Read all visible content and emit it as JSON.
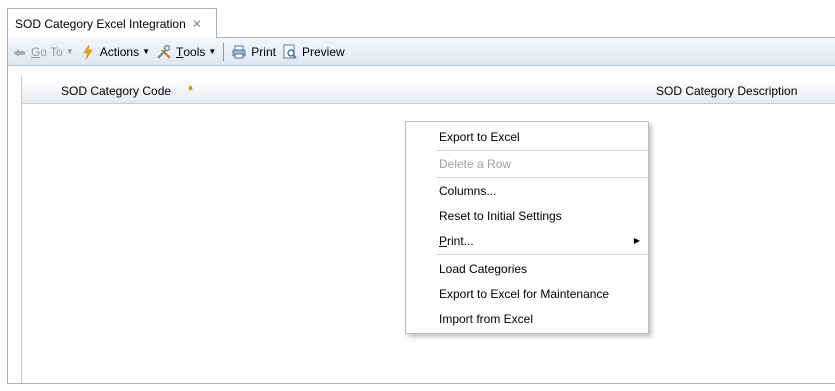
{
  "tab": {
    "title": "SOD Category Excel Integration",
    "close_glyph": "✕"
  },
  "toolbar": {
    "goto_label": "Go To",
    "goto_underline": "G",
    "goto_rest": "o To",
    "actions_label": "Actions",
    "tools_underline": "T",
    "tools_rest": "ools",
    "print_label": "Print",
    "preview_label": "Preview"
  },
  "grid": {
    "columns": [
      "SOD Category Code",
      "SOD Category Description"
    ],
    "sort_indicator": "♦"
  },
  "context_menu": {
    "items": [
      {
        "label": "Export to Excel",
        "enabled": true
      },
      {
        "label": "Delete a Row",
        "enabled": false
      },
      {
        "label": "Columns...",
        "enabled": true
      },
      {
        "label": "Reset to Initial Settings",
        "enabled": true
      },
      {
        "label_underline": "P",
        "label_rest": "rint...",
        "enabled": true,
        "submenu": true
      },
      {
        "label": "Load Categories",
        "enabled": true
      },
      {
        "label": "Export to Excel for Maintenance",
        "enabled": true
      },
      {
        "label": "Import from Excel",
        "enabled": true
      }
    ]
  },
  "colors": {
    "accent": "#dfe7f1",
    "border": "#a9b3c0",
    "disabled_text": "#a0a0a0"
  }
}
